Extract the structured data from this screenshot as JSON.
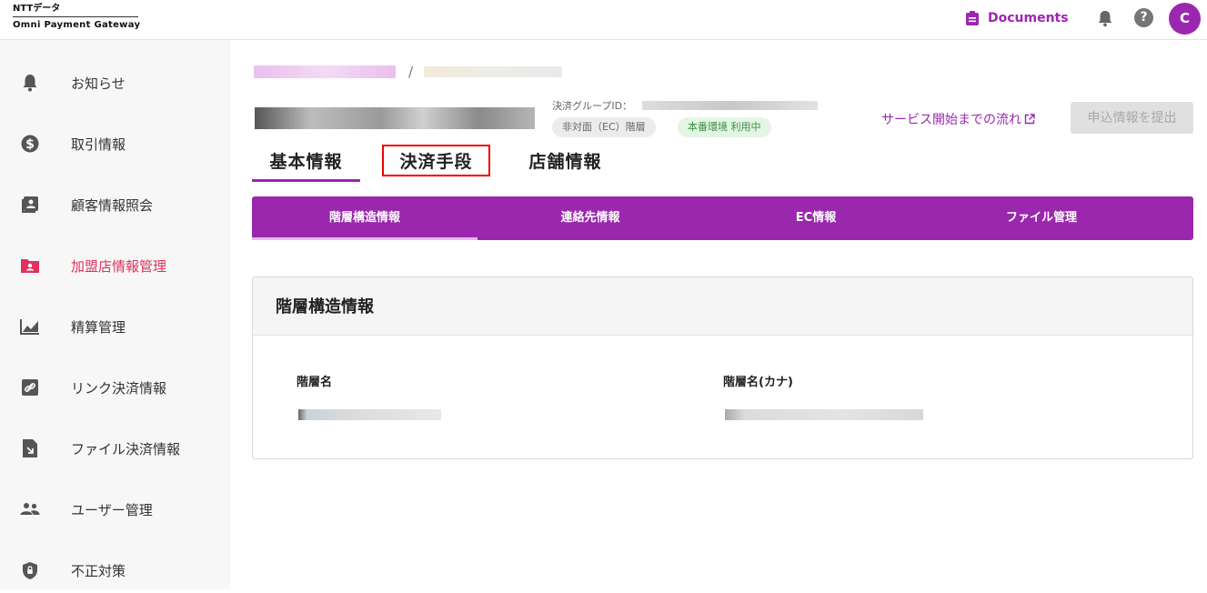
{
  "header": {
    "logo_line1": "NTTデータ",
    "logo_line2": "Omni Payment Gateway",
    "documents_label": "Documents",
    "help_label": "?",
    "avatar_initial": "C",
    "icons": [
      "clipboard-icon",
      "bell-icon",
      "help-icon"
    ]
  },
  "sidebar": {
    "items": [
      {
        "label": "お知らせ",
        "icon": "bell-icon"
      },
      {
        "label": "取引情報",
        "icon": "dollar-icon"
      },
      {
        "label": "顧客情報照会",
        "icon": "contacts-icon"
      },
      {
        "label": "加盟店情報管理",
        "icon": "folder-shared-icon",
        "active": true
      },
      {
        "label": "精算管理",
        "icon": "chart-icon"
      },
      {
        "label": "リンク決済情報",
        "icon": "link-icon"
      },
      {
        "label": "ファイル決済情報",
        "icon": "file-icon"
      },
      {
        "label": "ユーザー管理",
        "icon": "people-icon"
      },
      {
        "label": "不正対策",
        "icon": "shield-icon"
      }
    ]
  },
  "main": {
    "breadcrumb_sep": "/",
    "group_id_label": "決済グループID：",
    "chips": {
      "channel": "非対面（EC）階層",
      "env": "本番環境 利用中"
    },
    "flow_link": "サービス開始までの流れ",
    "submit_button": "申込情報を提出",
    "tabs": [
      "基本情報",
      "決済手段",
      "店舗情報"
    ],
    "subtabs": [
      "階層構造情報",
      "連絡先情報",
      "EC情報",
      "ファイル管理"
    ],
    "card": {
      "title": "階層構造情報",
      "field1_label": "階層名",
      "field2_label": "階層名(カナ)"
    }
  },
  "colors": {
    "brand": "#9b27af",
    "active_nav": "#e0325f",
    "highlight_border": "#ee0000"
  }
}
